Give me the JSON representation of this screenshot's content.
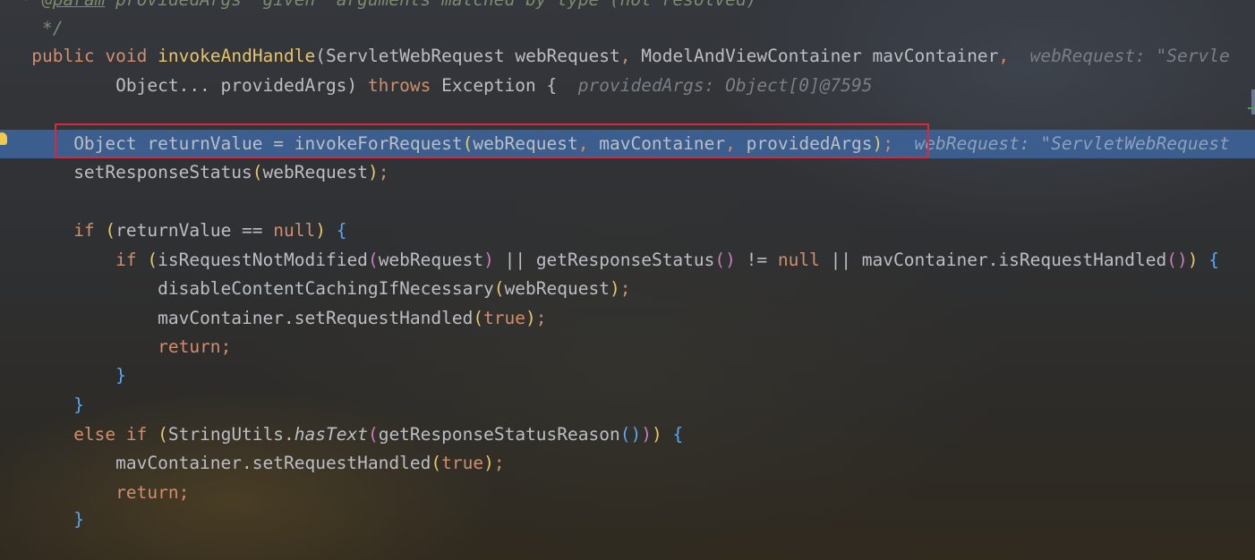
{
  "code": {
    "doc_tag": "@param",
    "doc_text": " providedArgs \"given\" arguments matched by type (not resolved)",
    "doc_end": "*/",
    "mod_public": "public",
    "mod_void": "void",
    "method_name": "invokeAndHandle",
    "param1": "ServletWebRequest webRequest",
    "param2": "ModelAndViewContainer mavContainer",
    "hint_line3": "webRequest: \"Servle",
    "param3": "Object... providedArgs",
    "kw_throws": "throws",
    "exc_type": "Exception",
    "hint_line4": "providedArgs: Object[0]@7595",
    "current_decl": "Object returnValue = ",
    "invoke_fn": "invokeForRequest",
    "arg_web": "webRequest",
    "arg_mav": "mavContainer",
    "arg_prov": "providedArgs",
    "hint_current": "webRequest: \"ServletWebRequest",
    "set_status": "setResponseStatus",
    "kw_if": "if",
    "return_value": "returnValue",
    "op_eq_null": " == ",
    "kw_null": "null",
    "is_not_modified": "isRequestNotModified",
    "op_or": " || ",
    "get_status": "getResponseStatus",
    "op_neq": " != ",
    "mav_is_handled": "mavContainer.isRequestHandled",
    "disable_caching": "disableContentCachingIfNecessary",
    "mav_set_handled": "mavContainer.setRequestHandled",
    "kw_true": "true",
    "kw_return": "return",
    "kw_else_if": "else if",
    "string_utils": "StringUtils.",
    "has_text": "hasText",
    "get_reason": "getResponseStatusReason"
  }
}
